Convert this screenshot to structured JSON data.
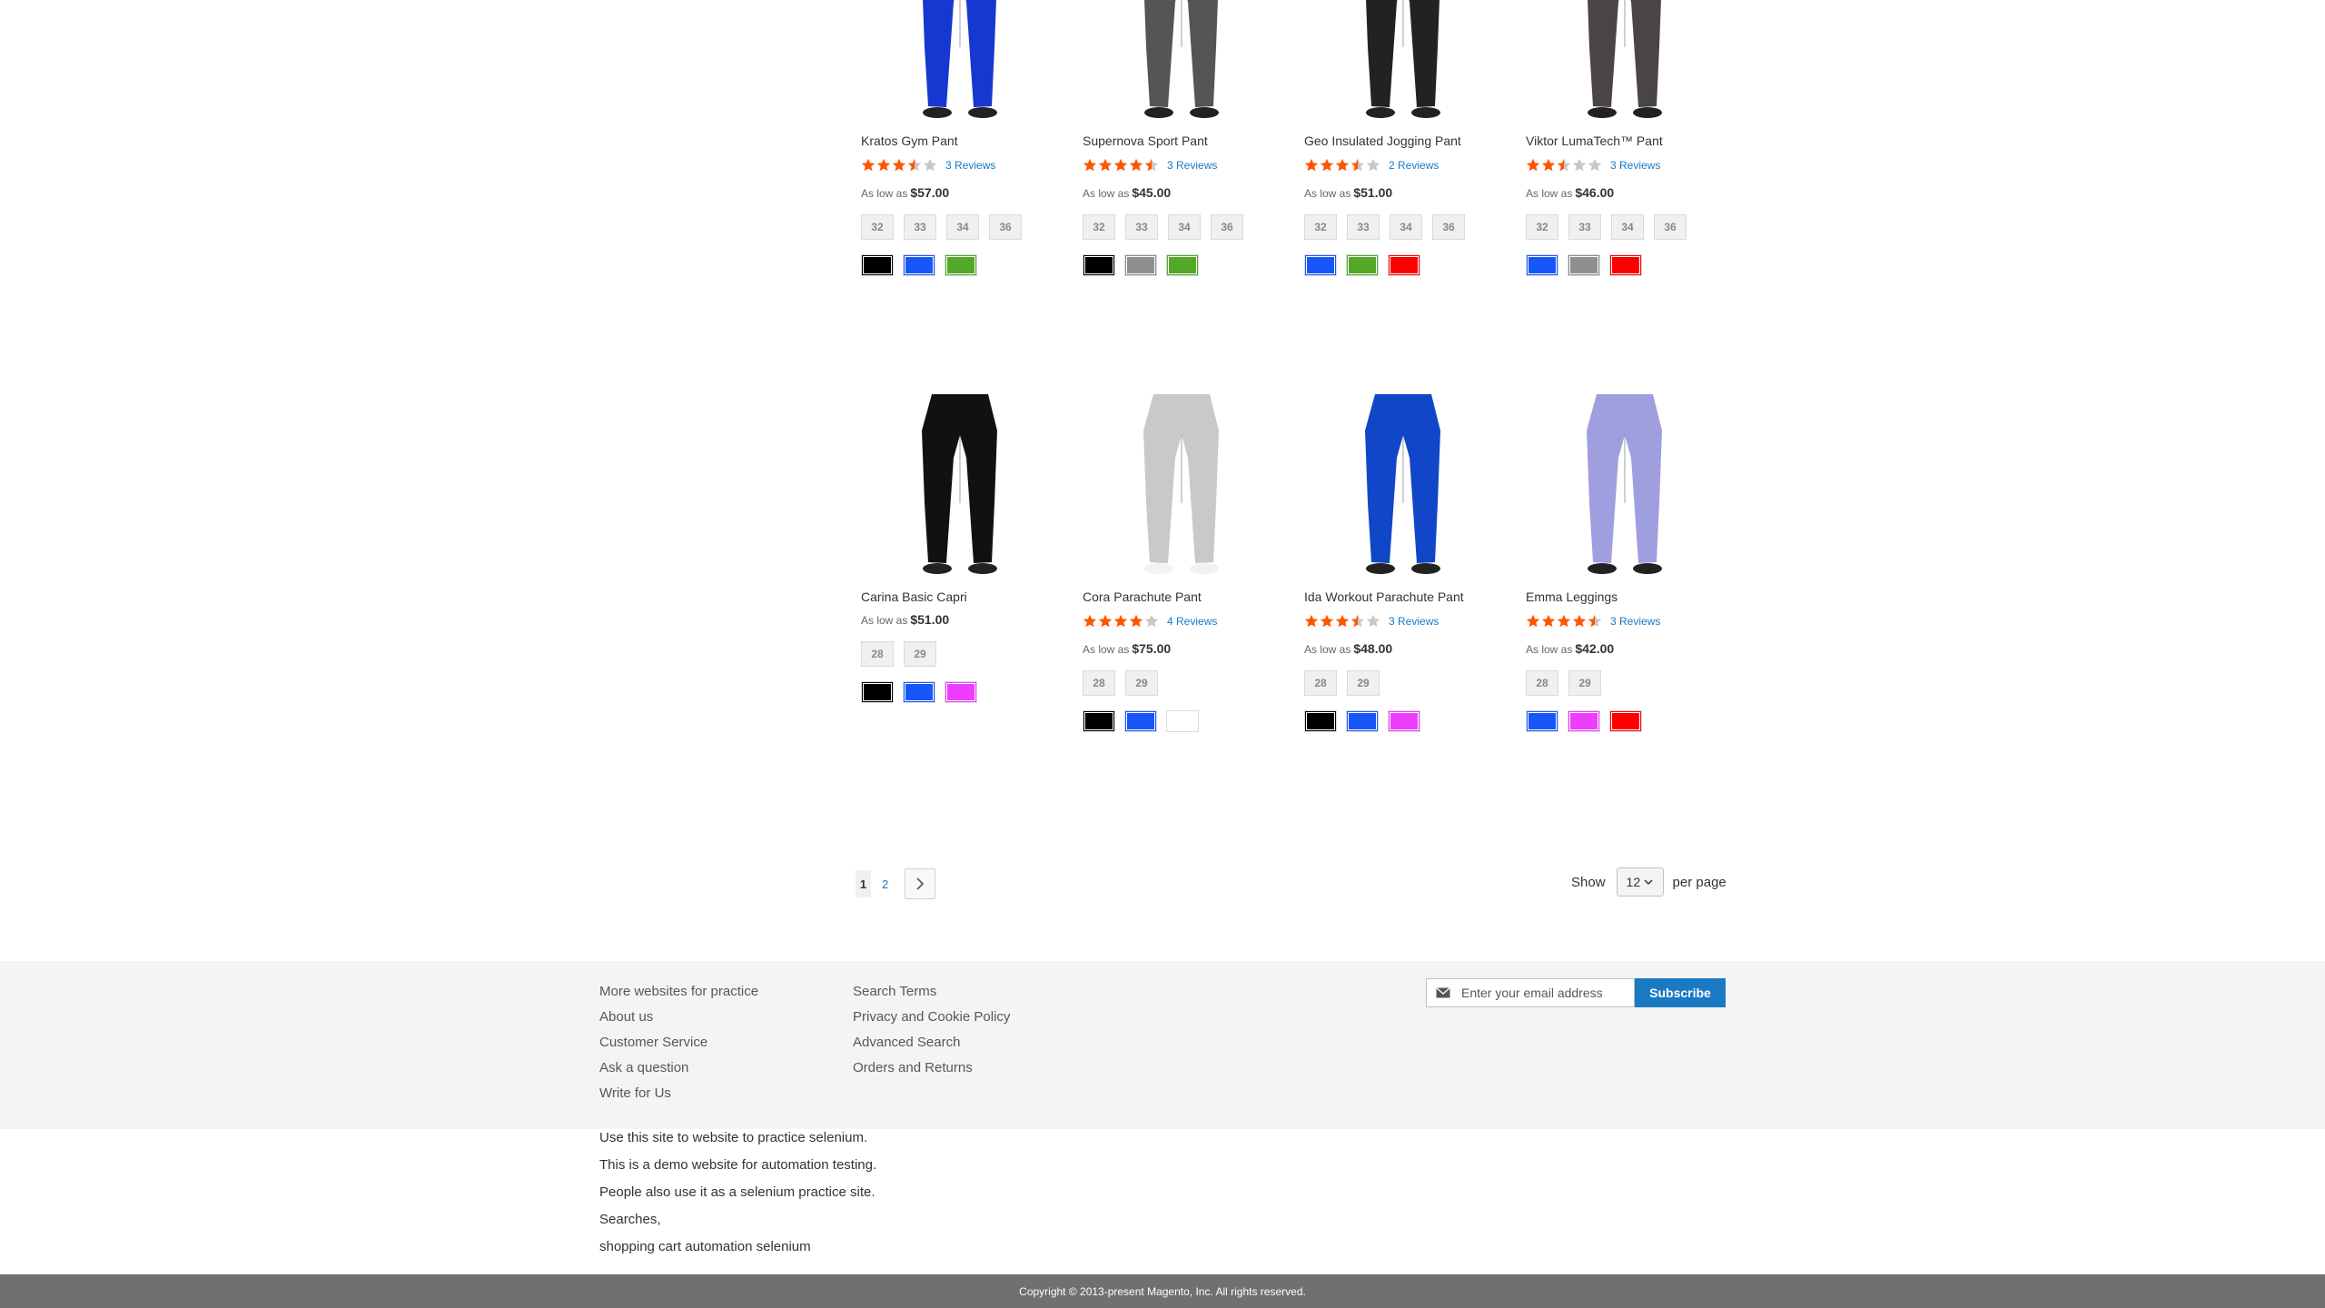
{
  "products": [
    {
      "name": "Kratos Gym Pant",
      "rating_percent": 70,
      "reviews": "3 Reviews",
      "price_label": "As low as",
      "price": "$57.00",
      "sizes": [
        "32",
        "33",
        "34",
        "36"
      ],
      "colors": [
        "#000000",
        "#1857f7",
        "#53a828"
      ],
      "image_color": "#1637d0"
    },
    {
      "name": "Supernova Sport Pant",
      "rating_percent": 90,
      "reviews": "3 Reviews",
      "price_label": "As low as",
      "price": "$45.00",
      "sizes": [
        "32",
        "33",
        "34",
        "36"
      ],
      "colors": [
        "#000000",
        "#8f8f8f",
        "#53a828"
      ],
      "image_color": "#555555"
    },
    {
      "name": "Geo Insulated Jogging Pant",
      "rating_percent": 70,
      "reviews": "2 Reviews",
      "price_label": "As low as",
      "price": "$51.00",
      "sizes": [
        "32",
        "33",
        "34",
        "36"
      ],
      "colors": [
        "#1857f7",
        "#53a828",
        "#ff0000"
      ],
      "image_color": "#222222"
    },
    {
      "name": "Viktor LumaTech™ Pant",
      "rating_percent": 50,
      "reviews": "3 Reviews",
      "price_label": "As low as",
      "price": "$46.00",
      "sizes": [
        "32",
        "33",
        "34",
        "36"
      ],
      "colors": [
        "#1857f7",
        "#8f8f8f",
        "#ff0000"
      ],
      "image_color": "#4a4448"
    },
    {
      "name": "Carina Basic Capri",
      "rating_percent": null,
      "reviews": "",
      "price_label": "As low as",
      "price": "$51.00",
      "sizes": [
        "28",
        "29"
      ],
      "colors": [
        "#000000",
        "#1857f7",
        "#ef3dff"
      ],
      "image_color": "#111111"
    },
    {
      "name": "Cora Parachute Pant",
      "rating_percent": 80,
      "reviews": "4 Reviews",
      "price_label": "As low as",
      "price": "$75.00",
      "sizes": [
        "28",
        "29"
      ],
      "colors": [
        "#000000",
        "#1857f7",
        "#ffffff"
      ],
      "image_color": "#c9c9cc"
    },
    {
      "name": "Ida Workout Parachute Pant",
      "rating_percent": 70,
      "reviews": "3 Reviews",
      "price_label": "As low as",
      "price": "$48.00",
      "sizes": [
        "28",
        "29"
      ],
      "colors": [
        "#000000",
        "#1857f7",
        "#ef3dff"
      ],
      "image_color": "#1146c9"
    },
    {
      "name": "Emma Leggings",
      "rating_percent": 90,
      "reviews": "3 Reviews",
      "price_label": "As low as",
      "price": "$42.00",
      "sizes": [
        "28",
        "29"
      ],
      "colors": [
        "#1857f7",
        "#ef3dff",
        "#ff0000"
      ],
      "image_color": "#9f9fe0"
    }
  ],
  "pager": {
    "current": "1",
    "next_page": "2"
  },
  "limiter": {
    "show_label": "Show",
    "value": "12",
    "per_page_label": "per page"
  },
  "footer": {
    "col1": [
      "More websites for practice",
      "About us",
      "Customer Service",
      "Ask a question",
      "Write for Us"
    ],
    "col2": [
      "Search Terms",
      "Privacy and Cookie Policy",
      "Advanced Search",
      "Orders and Returns"
    ],
    "newsletter": {
      "placeholder": "Enter your email address",
      "button": "Subscribe"
    }
  },
  "info_lines": [
    "Use this site to website to practice selenium.",
    "This is a demo website for automation testing.",
    "People also use it as a selenium practice site.",
    "Searches,",
    "shopping cart automation selenium"
  ],
  "copyright": "Copyright © 2013-present Magento, Inc. All rights reserved.",
  "colors": {
    "accent": "#1979c3",
    "star": "#ff5501",
    "footer_bg": "#f4f4f4",
    "copyright_bg": "#6e716e"
  }
}
